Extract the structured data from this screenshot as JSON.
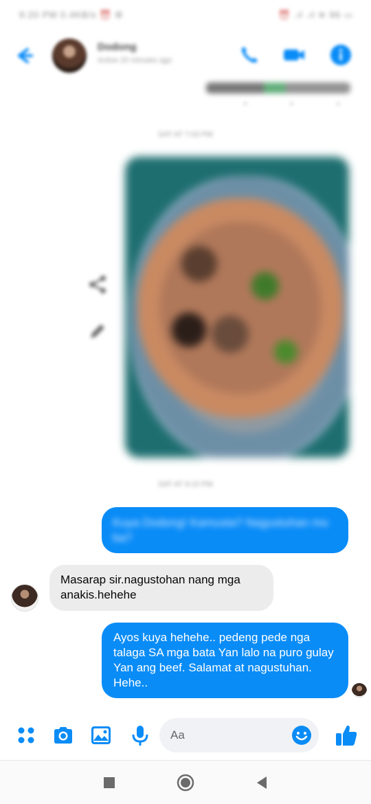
{
  "status_bar": {
    "left_text": "9:20 PM 0.4KB/s ⏰ ⚙",
    "right_text": "⏰ .ıl .ıl ≋ 96 ▭"
  },
  "header": {
    "contact_name": "Dodong",
    "contact_status": "Active 20 minutes ago"
  },
  "chat": {
    "timestamps": [
      "SAT AT 7:03 PM",
      "SAT AT 9:15 PM"
    ],
    "messages": [
      {
        "direction": "outgoing",
        "text": "Kuya Dodong! Kamusta? Nagustuhan mo ba?",
        "blurred": true
      },
      {
        "direction": "incoming",
        "text": "Masarap sir.nagustohan nang mga anakis.hehehe"
      },
      {
        "direction": "outgoing",
        "text": "Ayos kuya hehehe.. pedeng pede nga talaga SA mga bata Yan lalo na puro gulay Yan ang beef. Salamat at nagustuhan. Hehe.."
      }
    ]
  },
  "composer": {
    "placeholder": "Aa"
  },
  "colors": {
    "accent": "#0a8cf7",
    "incoming_bubble": "#ececec",
    "outgoing_bubble": "#0a8cf7"
  },
  "icons": {
    "header": [
      "back-arrow-icon",
      "phone-icon",
      "video-camera-icon",
      "info-icon"
    ],
    "composer": [
      "apps-grid-icon",
      "camera-icon",
      "image-icon",
      "microphone-icon",
      "emoji-icon",
      "thumbs-up-icon"
    ],
    "navigation": [
      "recents-square-icon",
      "home-circle-icon",
      "back-triangle-icon"
    ]
  }
}
